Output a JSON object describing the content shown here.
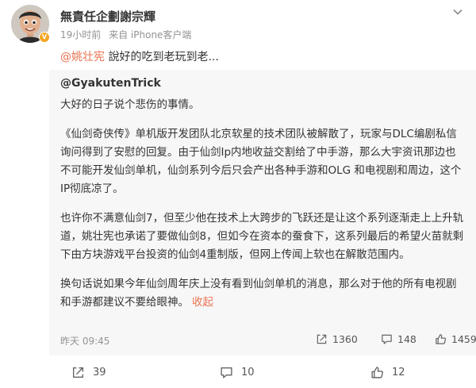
{
  "post": {
    "author": "無責任企劃謝宗輝",
    "time": "19小时前",
    "source": "来自 iPhone客户端",
    "mention": "@姚壮宪",
    "repost_comment": " 說好的吃到老玩到老..."
  },
  "quoted": {
    "author": "@GyakutenTrick",
    "paragraphs": [
      "大好的日子说个悲伤的事情。",
      "《仙剑奇侠传》单机版开发团队北京软星的技术团队被解散了，玩家与DLC编剧私信询问得到了安慰的回复。由于仙剑Ip内地收益交割给了中手游，那么大宇资讯那边也不可能开发仙剑单机，仙剑系列今后只会产出各种手游和OLG 和电视剧和周边，这个IP彻底凉了。",
      "也许你不满意仙剑7，但至少他在技术上大跨步的飞跃还是让这个系列逐渐走上上升轨道，姚壮宪也承诺了要做仙剑8，但如今在资本的蚕食下，这系列最后的希望火苗就剩下由方块游戏平台投资的仙剑4重制版，但网上传闻上软也在解散范围内。",
      "换句话说如果今年仙剑周年庆上没有看到仙剑单机的消息，那么对于他的所有电视剧和手游都建议不要给眼神。"
    ],
    "collapse_label": "收起",
    "time": "昨天 09:45",
    "reposts": "1360",
    "comments": "148",
    "likes": "1459"
  },
  "actions": {
    "reposts": "39",
    "comments": "10",
    "likes": "12"
  },
  "colors": {
    "accent": "#eb7350",
    "badge": "#f5a623",
    "quote_bg": "#f7f7f7"
  },
  "icons": [
    "avatar",
    "verified-badge-icon",
    "chevron-down-icon",
    "repost-icon",
    "comment-icon",
    "like-icon"
  ]
}
